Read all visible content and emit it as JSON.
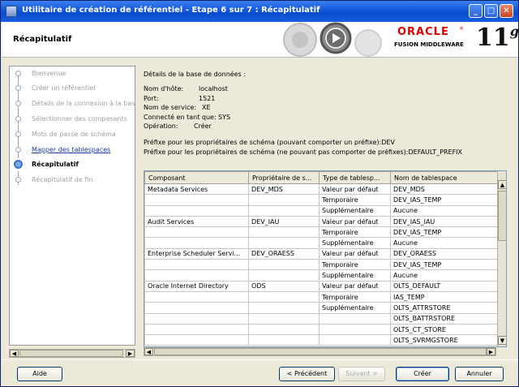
{
  "window": {
    "title": "Utilitaire de création de référentiel - Etape 6 sur 7 : Récapitulatif"
  },
  "header": {
    "page_title": "Récapitulatif",
    "brand": "ORACLE",
    "brand_reg": "®",
    "product": "FUSION MIDDLEWARE",
    "version": "11",
    "version_suffix": "g"
  },
  "nav": {
    "items": [
      {
        "label": "Bienvenue",
        "state": "done"
      },
      {
        "label": "Créer un référentiel",
        "state": "done"
      },
      {
        "label": "Détails de la connexion à la base de données",
        "state": "done"
      },
      {
        "label": "Sélectionner des composants",
        "state": "done"
      },
      {
        "label": "Mots de passe de schéma",
        "state": "done"
      },
      {
        "label": "Mapper des tablespaces",
        "state": "link"
      },
      {
        "label": "Récapitulatif",
        "state": "current"
      },
      {
        "label": "Récapitulatif de fin",
        "state": "todo"
      }
    ]
  },
  "db": {
    "heading": "Détails de la base de données :",
    "rows": [
      {
        "label": "Nom d'hôte:",
        "value": "localhost"
      },
      {
        "label": "Port:",
        "value": "1521"
      },
      {
        "label": "Nom de service:",
        "value": "XE"
      },
      {
        "label": "Connecté en tant que:",
        "value": "SYS"
      },
      {
        "label": "Opération:",
        "value": "Créer"
      }
    ]
  },
  "prefix": {
    "line1": "Préfixe pour les propriétaires de schéma (pouvant comporter un préfixe):DEV",
    "line2": "Préfixe pour les propriétaires de schéma (ne pouvant pas comporter de préfixes):DEFAULT_PREFIX"
  },
  "table": {
    "columns": [
      "Composant",
      "Propriétaire de s...",
      "Type de tablesp...",
      "Nom de tablespace"
    ],
    "rows": [
      [
        "Metadata Services",
        "DEV_MDS",
        "Valeur par défaut",
        "DEV_MDS"
      ],
      [
        "",
        "",
        "Temporaire",
        "DEV_IAS_TEMP"
      ],
      [
        "",
        "",
        "Supplémentaire",
        "Aucune"
      ],
      [
        "Audit Services",
        "DEV_IAU",
        "Valeur par défaut",
        "DEV_IAS_IAU"
      ],
      [
        "",
        "",
        "Temporaire",
        "DEV_IAS_TEMP"
      ],
      [
        "",
        "",
        "Supplémentaire",
        "Aucune"
      ],
      [
        "Enterprise Scheduler Servi...",
        "DEV_ORAESS",
        "Valeur par défaut",
        "DEV_ORAESS"
      ],
      [
        "",
        "",
        "Temporaire",
        "DEV_IAS_TEMP"
      ],
      [
        "",
        "",
        "Supplémentaire",
        "Aucune"
      ],
      [
        "Oracle Internet Directory",
        "ODS",
        "Valeur par défaut",
        "OLTS_DEFAULT"
      ],
      [
        "",
        "",
        "Temporaire",
        "IAS_TEMP"
      ],
      [
        "",
        "",
        "Supplémentaire",
        "OLTS_ATTRSTORE"
      ],
      [
        "",
        "",
        "",
        "OLTS_BATTRSTORE"
      ],
      [
        "",
        "",
        "",
        "OLTS_CT_STORE"
      ],
      [
        "",
        "",
        "",
        "OLTS_SVRMGSTORE"
      ]
    ]
  },
  "buttons": {
    "help": "Aide",
    "previous": "< Précédent",
    "next": "Suivant >",
    "create": "Créer",
    "cancel": "Annuler"
  },
  "colors": {
    "titlebar": "#0b4cd0",
    "link": "#1a3aa8",
    "oracle_red": "#e00000",
    "current_step": "#3970c8"
  }
}
